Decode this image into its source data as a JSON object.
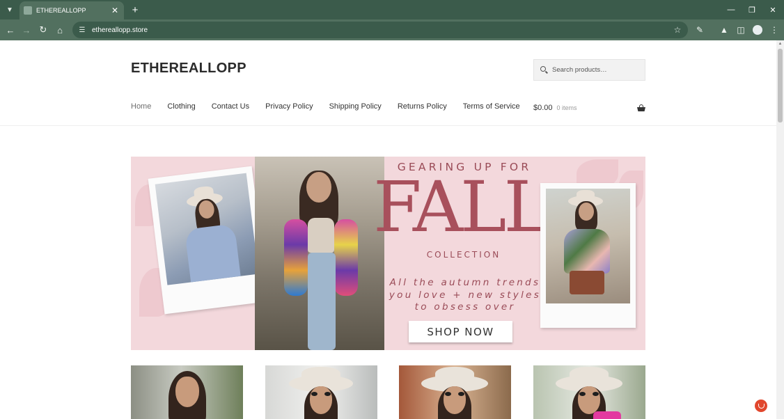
{
  "browser": {
    "tab_title": "ETHEREALLOPP",
    "url": "ethereallopp.store",
    "icons": [
      "tab-list-icon",
      "close-icon",
      "plus-icon",
      "minimize-icon",
      "restore-icon",
      "back-icon",
      "forward-icon",
      "reload-icon",
      "home-icon",
      "site-settings-icon",
      "bookmark-star-icon",
      "extensions-icon",
      "labs-icon",
      "sidebar-icon",
      "profile-icon",
      "kebab-menu-icon"
    ]
  },
  "site": {
    "brand": "ETHEREALLOPP",
    "search_placeholder": "Search products…",
    "nav": [
      "Home",
      "Clothing",
      "Contact Us",
      "Privacy Policy",
      "Shipping Policy",
      "Returns Policy",
      "Terms of Service"
    ],
    "active_nav": "Home",
    "cart": {
      "amount": "$0.00",
      "count": "0 items"
    }
  },
  "hero": {
    "line1": "GEARING UP FOR",
    "headline": "FALL",
    "line2": "COLLECTION",
    "tagline": [
      "All the autumn trends",
      "you love + new styles",
      "to obsess over"
    ],
    "cta": "SHOP NOW",
    "colors": {
      "background": "#f3d8dc",
      "accent": "#a8505c"
    }
  },
  "products": [
    {
      "image": "woman-with-long-dark-hair"
    },
    {
      "image": "woman-in-hat-and-sunglasses"
    },
    {
      "image": "woman-in-hat-and-sunglasses"
    },
    {
      "image": "woman-in-hat-and-sunglasses"
    }
  ]
}
